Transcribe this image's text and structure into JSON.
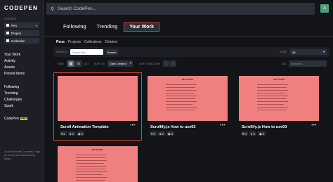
{
  "brand": {
    "logo": "CODEPEN"
  },
  "sidebar": {
    "create_label": "CREATE",
    "create_items": [
      {
        "label": "Pen",
        "icon": "pen-square-icon"
      },
      {
        "label": "Project",
        "icon": "project-square-icon"
      },
      {
        "label": "Collection",
        "icon": "collection-square-icon"
      }
    ],
    "nav_group1": [
      "Your Work",
      "Activity",
      "Assets",
      "Pinned Items"
    ],
    "nav_group2": [
      "Following",
      "Trending",
      "Challenges",
      "Spark"
    ],
    "codepen_pro": {
      "label": "CodePen",
      "badge": "PRO"
    },
    "footer_text": "Go API-first with Contentful. Sign up for free and start building today."
  },
  "topbar": {
    "search_placeholder": "Search CodePen...",
    "avatar_initial": "A"
  },
  "tabs": [
    {
      "label": "Following",
      "active": false
    },
    {
      "label": "Trending",
      "active": false
    },
    {
      "label": "Your Work",
      "active": true
    }
  ],
  "subtabs": [
    {
      "label": "Pens",
      "active": true
    },
    {
      "label": "Projects",
      "active": false
    },
    {
      "label": "Collections",
      "active": false
    },
    {
      "label": "Deleted",
      "active": false
    }
  ],
  "filters": {
    "search_label": "SEARCH",
    "search_placeholder": "Search for...",
    "search_button": "Search",
    "view_label": "VIEW",
    "view_value": "All"
  },
  "controls": {
    "grid_label": "GRID",
    "list_label": "LIST",
    "sort_by_label": "SORT BY",
    "sort_by_value": "Date Created",
    "sort_direction_label": "SORT DIRECTION",
    "tag_label": "TAG",
    "tag_placeholder": "Keyword..."
  },
  "cards": [
    {
      "title": "Scroll Animation Template",
      "hearts": "0",
      "comments": "0",
      "views": "0",
      "doc_heading": "",
      "thumb_color": "#f08080"
    },
    {
      "title": "Scrollify.js How to use02",
      "hearts": "0",
      "comments": "0",
      "views": "0",
      "doc_heading": "SECTION01",
      "thumb_color": "#f08080"
    },
    {
      "title": "Scrollify.js How to use03",
      "hearts": "0",
      "comments": "0",
      "views": "0",
      "doc_heading": "SECTION01",
      "thumb_color": "#f08080"
    },
    {
      "title": "",
      "hearts": "",
      "comments": "",
      "views": "",
      "doc_heading": "SECTION01",
      "thumb_color": "#f08080"
    }
  ],
  "colors": {
    "accent_highlight": "#e0412f",
    "sidebar_bg": "#1e1f26",
    "page_bg": "#131417",
    "pro_badge": "#ffdd40"
  }
}
